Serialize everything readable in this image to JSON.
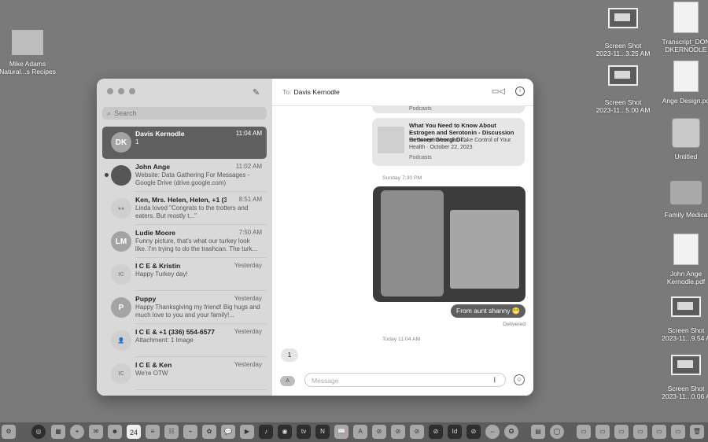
{
  "desktop": {
    "left_icon": {
      "line1": "Mike Adams",
      "line2": "Natural...s Recipes"
    },
    "right_icons": [
      {
        "line1": "Screen Shot",
        "line2": "2023-11...3.25 AM"
      },
      {
        "line1": "Transcript_DON",
        "line2": "DKERNODLE"
      },
      {
        "line1": "Screen Shot",
        "line2": "2023-11...5.00 AM"
      },
      {
        "line1": "Ange Design.pd",
        "line2": ""
      },
      {
        "line1": "Untitled",
        "line2": ""
      },
      {
        "line1": "Family Medica",
        "line2": ""
      },
      {
        "line1": "John Ange",
        "line2": "Kernodle.pdf"
      },
      {
        "line1": "Screen Shot",
        "line2": "2023-11...9.54 A"
      },
      {
        "line1": "Screen Shot",
        "line2": "2023-11...0.06 A"
      }
    ]
  },
  "messages": {
    "search_placeholder": "Search",
    "conversations": [
      {
        "initials": "DK",
        "name": "Davis Kernodle",
        "time": "11:04 AM",
        "preview": "1"
      },
      {
        "initials": "",
        "name": "John Ange",
        "time": "11:02 AM",
        "preview": "Website: Data Gathering For Messages - Google Drive (drive.google.com)"
      },
      {
        "initials": "",
        "name": "Ken, Mrs. Helen, Helen, +1 (3...",
        "time": "8:51 AM",
        "preview": "Linda loved \"Congrats to the trotters and eaters.  But mostly t...\""
      },
      {
        "initials": "LM",
        "name": "Ludie Moore",
        "time": "7:50 AM",
        "preview": "Funny picture, that's what our turkey look like. I'm trying to do the trashcan. The turk..."
      },
      {
        "initials": "IC",
        "name": "I C E & Kristin",
        "time": "Yesterday",
        "preview": "Happy Turkey day!"
      },
      {
        "initials": "P",
        "name": "Puppy",
        "time": "Yesterday",
        "preview": "Happy Thanksgiving my friend! Big hugs and much love to you and your family!..."
      },
      {
        "initials": "",
        "name": "I C E & +1 (336) 554-6577",
        "time": "Yesterday",
        "preview": "Attachment: 1 Image"
      },
      {
        "initials": "IC",
        "name": "I C E & Ken",
        "time": "Yesterday",
        "preview": "We're OTW"
      }
    ],
    "chat": {
      "to_label": "To:",
      "recipient": "Davis Kernodle",
      "podcast_source_top": "Podcasts",
      "card_title": "What You Need to Know About Estrogen and Serotonin - Discussion Between Georgi Di...",
      "card_sub": "Dr. Joseph Mercola - Take Control of Your Health · October 22, 2023",
      "card_source": "Podcasts",
      "ts_sunday": "Sunday 7:30 PM",
      "outgoing": "From aunt shanny 😁",
      "delivered": "Delivered",
      "ts_today": "Today 11:04 AM",
      "incoming": "1",
      "message_placeholder": "Message"
    }
  },
  "dock": {
    "calendar_day": "24",
    "calendar_month": "NOV"
  }
}
